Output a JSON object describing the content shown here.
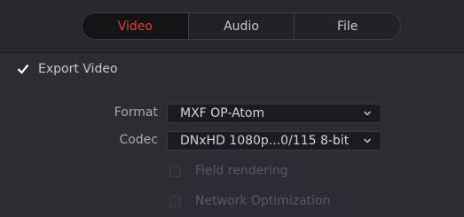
{
  "tabs": [
    {
      "label": "Video",
      "active": true
    },
    {
      "label": "Audio",
      "active": false
    },
    {
      "label": "File",
      "active": false
    }
  ],
  "export_video": {
    "label": "Export Video",
    "checked": true
  },
  "format": {
    "label": "Format",
    "value": "MXF OP-Atom"
  },
  "codec": {
    "label": "Codec",
    "value": "DNxHD 1080p...0/115 8-bit"
  },
  "options": [
    {
      "label": "Field rendering",
      "checked": false,
      "enabled": false
    },
    {
      "label": "Network Optimization",
      "checked": false,
      "enabled": false
    }
  ],
  "colors": {
    "accent": "#e0403a",
    "background": "#2c2c32",
    "field_bg": "#1c1c20"
  }
}
